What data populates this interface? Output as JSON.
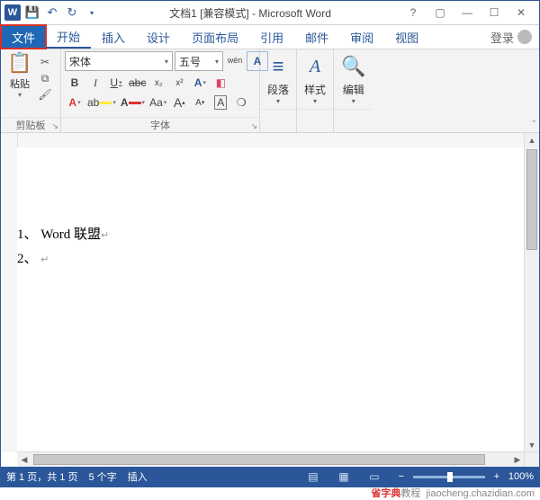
{
  "title": "文档1 [兼容模式] - Microsoft Word",
  "qat": {
    "save": "save",
    "undo": "undo",
    "redo": "redo"
  },
  "tabs": {
    "file": "文件",
    "home": "开始",
    "insert": "插入",
    "design": "设计",
    "layout": "页面布局",
    "references": "引用",
    "mail": "邮件",
    "review": "审阅",
    "view": "视图"
  },
  "signin": "登录",
  "ribbon": {
    "clipboard": {
      "paste": "粘贴",
      "label": "剪贴板"
    },
    "font": {
      "name": "宋体",
      "size": "五号",
      "phonetic": "wén",
      "clear_icon": "A",
      "buttons": {
        "bold": "B",
        "italic": "I",
        "underline": "U",
        "strike": "abc",
        "sub": "x₂",
        "sup": "x²"
      },
      "row3": {
        "effects": "A",
        "highlight": "ab",
        "color": "A",
        "case": "Aa",
        "grow": "A",
        "shrink": "A",
        "charborder": "A",
        "charshade": "❍"
      },
      "label": "字体"
    },
    "paragraph": {
      "label": "段落"
    },
    "styles": {
      "label": "样式"
    },
    "editing": {
      "label": "编辑"
    }
  },
  "document": {
    "lines": [
      "1、 Word 联盟",
      "2、"
    ]
  },
  "status": {
    "page": "第 1 页，共 1 页",
    "words": "5 个字",
    "mode": "插入",
    "zoom": "100%"
  },
  "footer": {
    "site": "省字典",
    "suffix": "教程",
    "url": "jiaocheng.chazidian.com"
  }
}
